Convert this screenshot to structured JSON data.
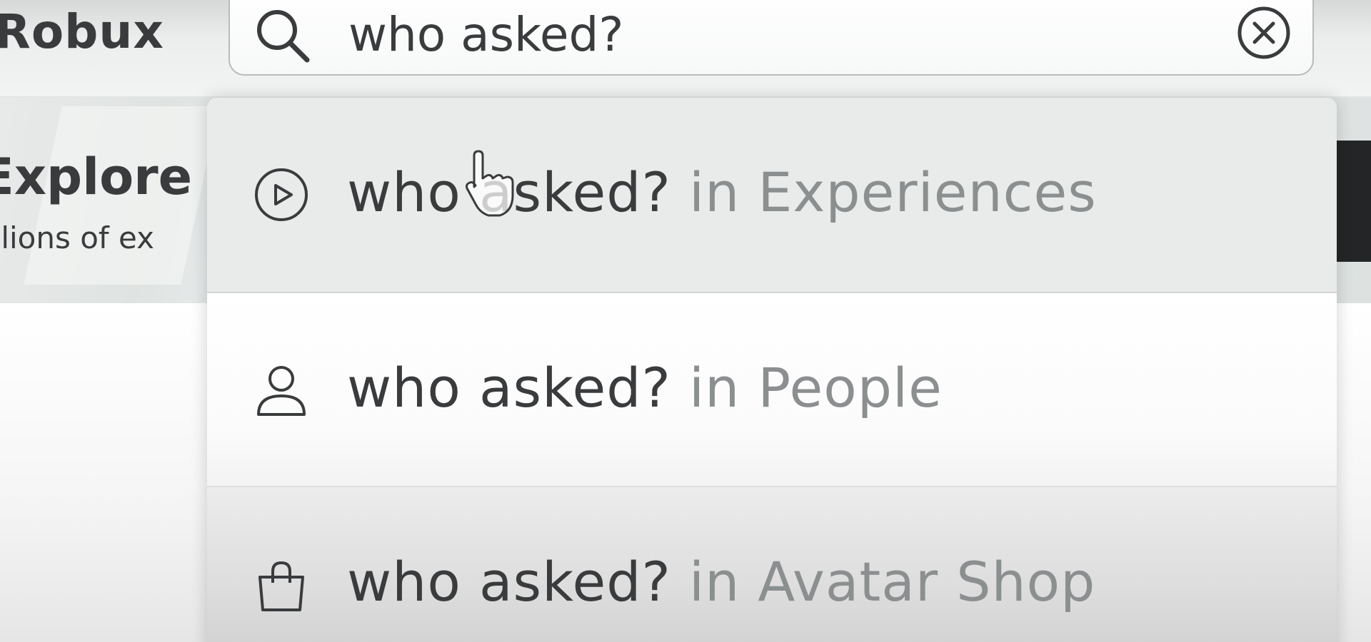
{
  "nav": {
    "robux_label": "Robux"
  },
  "search": {
    "value": "who asked?",
    "icon": "search-icon",
    "clear_icon": "close-circle-icon"
  },
  "banner": {
    "title": "Explore",
    "subtitle": "illions of ex"
  },
  "dropdown": {
    "items": [
      {
        "query": "who asked?",
        "scope": " in Experiences",
        "icon": "play-circle-icon",
        "highlighted": true
      },
      {
        "query": "who asked?",
        "scope": " in People",
        "icon": "person-icon",
        "highlighted": false
      },
      {
        "query": "who asked?",
        "scope": " in Avatar Shop",
        "icon": "shopping-bag-icon",
        "highlighted": false
      }
    ]
  },
  "colors": {
    "text_primary": "#393b3d",
    "text_secondary": "#8c8f90",
    "highlight_row": "#e9ebea"
  }
}
